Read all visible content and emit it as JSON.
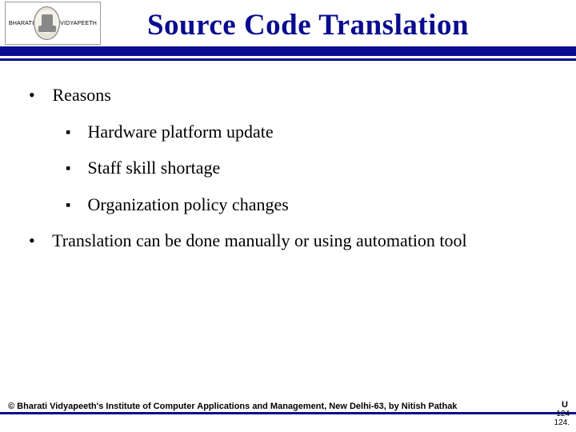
{
  "header": {
    "logo_left": "BHARATI",
    "logo_right": "VIDYAPEETH",
    "title": "Source Code Translation"
  },
  "content": {
    "b1": "Reasons",
    "sub": {
      "s1": "Hardware platform update",
      "s2": "Staff skill shortage",
      "s3": "Organization policy changes"
    },
    "b2": "Translation can be done manually or using automation tool"
  },
  "footer": {
    "copyright": "© Bharati Vidyapeeth's Institute of Computer Applications and Management, New Delhi-63, by Nitish Pathak",
    "page_a": "124",
    "page_b": "124.",
    "badge": "U"
  }
}
